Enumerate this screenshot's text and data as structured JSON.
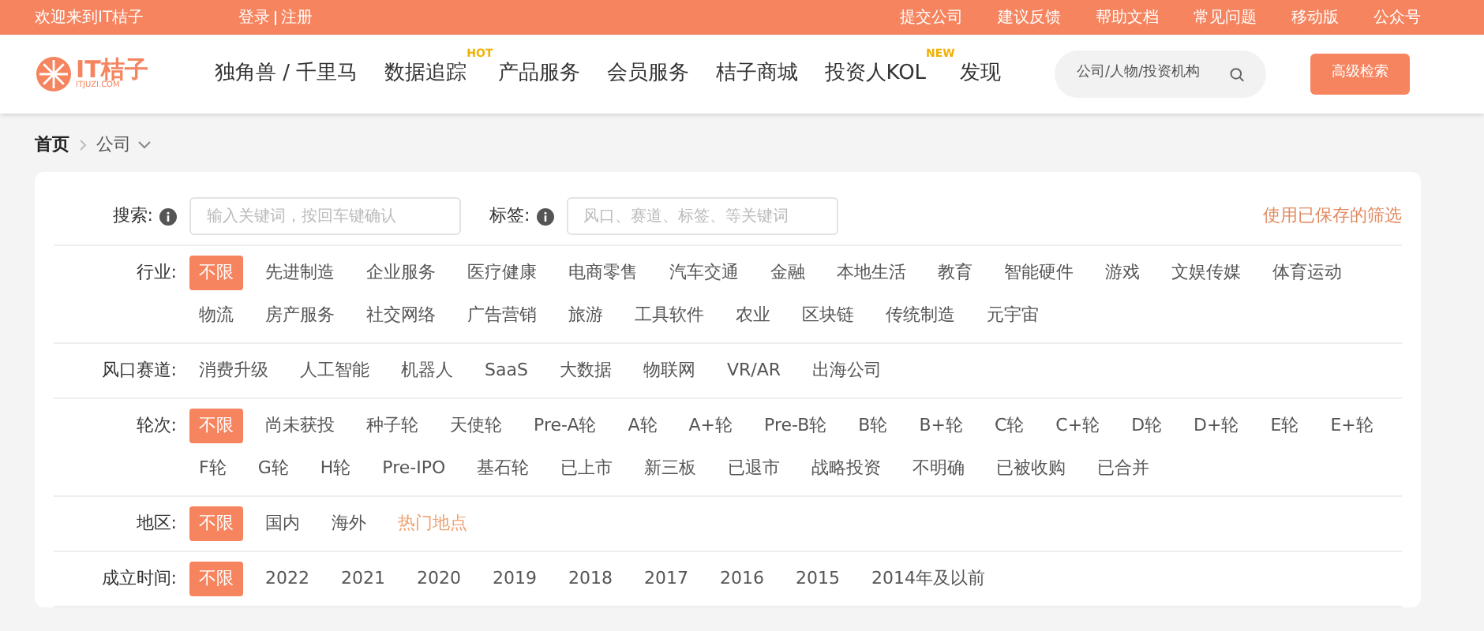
{
  "top_bar": {
    "welcome": "欢迎来到IT桔子",
    "auth_links": [
      "登录",
      "注册"
    ],
    "links": [
      "提交公司",
      "建议反馈",
      "帮助文档",
      "常见问题",
      "移动版",
      "公众号"
    ]
  },
  "header": {
    "logo": {
      "name": "IT桔子",
      "domain": "ITJUZI.COM"
    },
    "nav": [
      {
        "label": "独角兽 / 千里马"
      },
      {
        "label": "数据追踪",
        "badge": "HOT"
      },
      {
        "label": "产品服务"
      },
      {
        "label": "会员服务"
      },
      {
        "label": "桔子商城"
      },
      {
        "label": "投资人KOL",
        "badge": "NEW"
      },
      {
        "label": "发现"
      }
    ],
    "search": {
      "placeholder": "公司/人物/投资机构"
    },
    "advanced_button": "高级检索"
  },
  "breadcrumb": [
    "首页",
    "公司"
  ],
  "search_row": {
    "search_label": "搜索:",
    "search_placeholder": "输入关键词，按回车键确认",
    "tag_label": "标签:",
    "tag_placeholder": "风口、赛道、标签、等关键词",
    "saved_filters": "使用已保存的筛选"
  },
  "filters": [
    {
      "label": "行业:",
      "options": [
        {
          "text": "不限",
          "selected": true,
          "kind": "option"
        },
        {
          "text": "先进制造",
          "selected": false,
          "kind": "option"
        },
        {
          "text": "企业服务",
          "selected": false,
          "kind": "option"
        },
        {
          "text": "医疗健康",
          "selected": false,
          "kind": "option"
        },
        {
          "text": "电商零售",
          "selected": false,
          "kind": "option"
        },
        {
          "text": "汽车交通",
          "selected": false,
          "kind": "option"
        },
        {
          "text": "金融",
          "selected": false,
          "kind": "option"
        },
        {
          "text": "本地生活",
          "selected": false,
          "kind": "option"
        },
        {
          "text": "教育",
          "selected": false,
          "kind": "option"
        },
        {
          "text": "智能硬件",
          "selected": false,
          "kind": "option"
        },
        {
          "text": "游戏",
          "selected": false,
          "kind": "option"
        },
        {
          "text": "文娱传媒",
          "selected": false,
          "kind": "option"
        },
        {
          "text": "体育运动",
          "selected": false,
          "kind": "option"
        },
        {
          "text": "物流",
          "selected": false,
          "kind": "option"
        },
        {
          "text": "房产服务",
          "selected": false,
          "kind": "option"
        },
        {
          "text": "社交网络",
          "selected": false,
          "kind": "option"
        },
        {
          "text": "广告营销",
          "selected": false,
          "kind": "option"
        },
        {
          "text": "旅游",
          "selected": false,
          "kind": "option"
        },
        {
          "text": "工具软件",
          "selected": false,
          "kind": "option"
        },
        {
          "text": "农业",
          "selected": false,
          "kind": "option"
        },
        {
          "text": "区块链",
          "selected": false,
          "kind": "option"
        },
        {
          "text": "传统制造",
          "selected": false,
          "kind": "option"
        },
        {
          "text": "元宇宙",
          "selected": false,
          "kind": "option"
        }
      ]
    },
    {
      "label": "风口赛道:",
      "options": [
        {
          "text": "消费升级",
          "selected": false,
          "kind": "option"
        },
        {
          "text": "人工智能",
          "selected": false,
          "kind": "option"
        },
        {
          "text": "机器人",
          "selected": false,
          "kind": "option"
        },
        {
          "text": "SaaS",
          "selected": false,
          "kind": "option"
        },
        {
          "text": "大数据",
          "selected": false,
          "kind": "option"
        },
        {
          "text": "物联网",
          "selected": false,
          "kind": "option"
        },
        {
          "text": "VR/AR",
          "selected": false,
          "kind": "option"
        },
        {
          "text": "出海公司",
          "selected": false,
          "kind": "option"
        }
      ]
    },
    {
      "label": "轮次:",
      "options": [
        {
          "text": "不限",
          "selected": true,
          "kind": "option"
        },
        {
          "text": "尚未获投",
          "selected": false,
          "kind": "option"
        },
        {
          "text": "种子轮",
          "selected": false,
          "kind": "option"
        },
        {
          "text": "天使轮",
          "selected": false,
          "kind": "option"
        },
        {
          "text": "Pre-A轮",
          "selected": false,
          "kind": "option"
        },
        {
          "text": "A轮",
          "selected": false,
          "kind": "option"
        },
        {
          "text": "A+轮",
          "selected": false,
          "kind": "option"
        },
        {
          "text": "Pre-B轮",
          "selected": false,
          "kind": "option"
        },
        {
          "text": "B轮",
          "selected": false,
          "kind": "option"
        },
        {
          "text": "B+轮",
          "selected": false,
          "kind": "option"
        },
        {
          "text": "C轮",
          "selected": false,
          "kind": "option"
        },
        {
          "text": "C+轮",
          "selected": false,
          "kind": "option"
        },
        {
          "text": "D轮",
          "selected": false,
          "kind": "option"
        },
        {
          "text": "D+轮",
          "selected": false,
          "kind": "option"
        },
        {
          "text": "E轮",
          "selected": false,
          "kind": "option"
        },
        {
          "text": "E+轮",
          "selected": false,
          "kind": "option"
        },
        {
          "text": "F轮",
          "selected": false,
          "kind": "option"
        },
        {
          "text": "G轮",
          "selected": false,
          "kind": "option"
        },
        {
          "text": "H轮",
          "selected": false,
          "kind": "option"
        },
        {
          "text": "Pre-IPO",
          "selected": false,
          "kind": "option"
        },
        {
          "text": "基石轮",
          "selected": false,
          "kind": "option"
        },
        {
          "text": "已上市",
          "selected": false,
          "kind": "option"
        },
        {
          "text": "新三板",
          "selected": false,
          "kind": "option"
        },
        {
          "text": "已退市",
          "selected": false,
          "kind": "option"
        },
        {
          "text": "战略投资",
          "selected": false,
          "kind": "option"
        },
        {
          "text": "不明确",
          "selected": false,
          "kind": "option"
        },
        {
          "text": "已被收购",
          "selected": false,
          "kind": "option"
        },
        {
          "text": "已合并",
          "selected": false,
          "kind": "option"
        }
      ]
    },
    {
      "label": "地区:",
      "options": [
        {
          "text": "不限",
          "selected": true,
          "kind": "option"
        },
        {
          "text": "国内",
          "selected": false,
          "kind": "option"
        },
        {
          "text": "海外",
          "selected": false,
          "kind": "option"
        },
        {
          "text": "热门地点",
          "selected": false,
          "kind": "link"
        }
      ]
    },
    {
      "label": "成立时间:",
      "options": [
        {
          "text": "不限",
          "selected": true,
          "kind": "option"
        },
        {
          "text": "2022",
          "selected": false,
          "kind": "option"
        },
        {
          "text": "2021",
          "selected": false,
          "kind": "option"
        },
        {
          "text": "2020",
          "selected": false,
          "kind": "option"
        },
        {
          "text": "2019",
          "selected": false,
          "kind": "option"
        },
        {
          "text": "2018",
          "selected": false,
          "kind": "option"
        },
        {
          "text": "2017",
          "selected": false,
          "kind": "option"
        },
        {
          "text": "2016",
          "selected": false,
          "kind": "option"
        },
        {
          "text": "2015",
          "selected": false,
          "kind": "option"
        },
        {
          "text": "2014年及以前",
          "selected": false,
          "kind": "option"
        }
      ]
    }
  ]
}
